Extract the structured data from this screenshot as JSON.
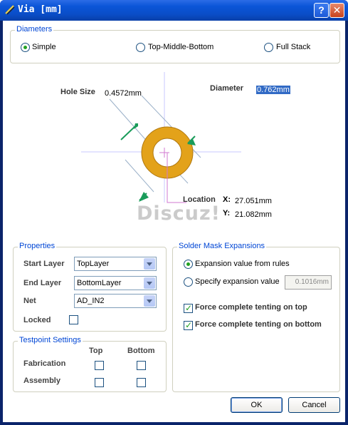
{
  "window": {
    "title": "Via [mm]",
    "help_label": "?",
    "close_label": "✕"
  },
  "diameters": {
    "group_title": "Diameters",
    "options": [
      {
        "label": "Simple",
        "checked": true
      },
      {
        "label": "Top-Middle-Bottom",
        "checked": false
      },
      {
        "label": "Full Stack",
        "checked": false
      }
    ]
  },
  "diagram": {
    "hole_size_label": "Hole Size",
    "hole_size_value": "0.4572mm",
    "diameter_label": "Diameter",
    "diameter_value": "0.762mm",
    "location_label": "Location",
    "x_label": "X:",
    "x_value": "27.051mm",
    "y_label": "Y:",
    "y_value": "21.082mm",
    "watermark": "Discuz!",
    "colors": {
      "pad": "#e3a21a",
      "hole": "#ffffff",
      "arrow": "#1a9c5a",
      "crosshair": "#c8c8ff",
      "leader": "#d27ad2"
    }
  },
  "properties": {
    "group_title": "Properties",
    "start_layer_label": "Start Layer",
    "start_layer_value": "TopLayer",
    "end_layer_label": "End Layer",
    "end_layer_value": "BottomLayer",
    "net_label": "Net",
    "net_value": "AD_IN2",
    "locked_label": "Locked",
    "locked_checked": false
  },
  "testpoint": {
    "group_title": "Testpoint Settings",
    "col_top": "Top",
    "col_bottom": "Bottom",
    "fabrication_label": "Fabrication",
    "assembly_label": "Assembly"
  },
  "solder_mask": {
    "group_title": "Solder Mask Expansions",
    "rules_label": "Expansion value from rules",
    "specify_label": "Specify expansion value",
    "specify_value": "0.1016mm",
    "tent_top_label": "Force complete tenting on top",
    "tent_bottom_label": "Force complete tenting on bottom"
  },
  "buttons": {
    "ok": "OK",
    "cancel": "Cancel"
  }
}
